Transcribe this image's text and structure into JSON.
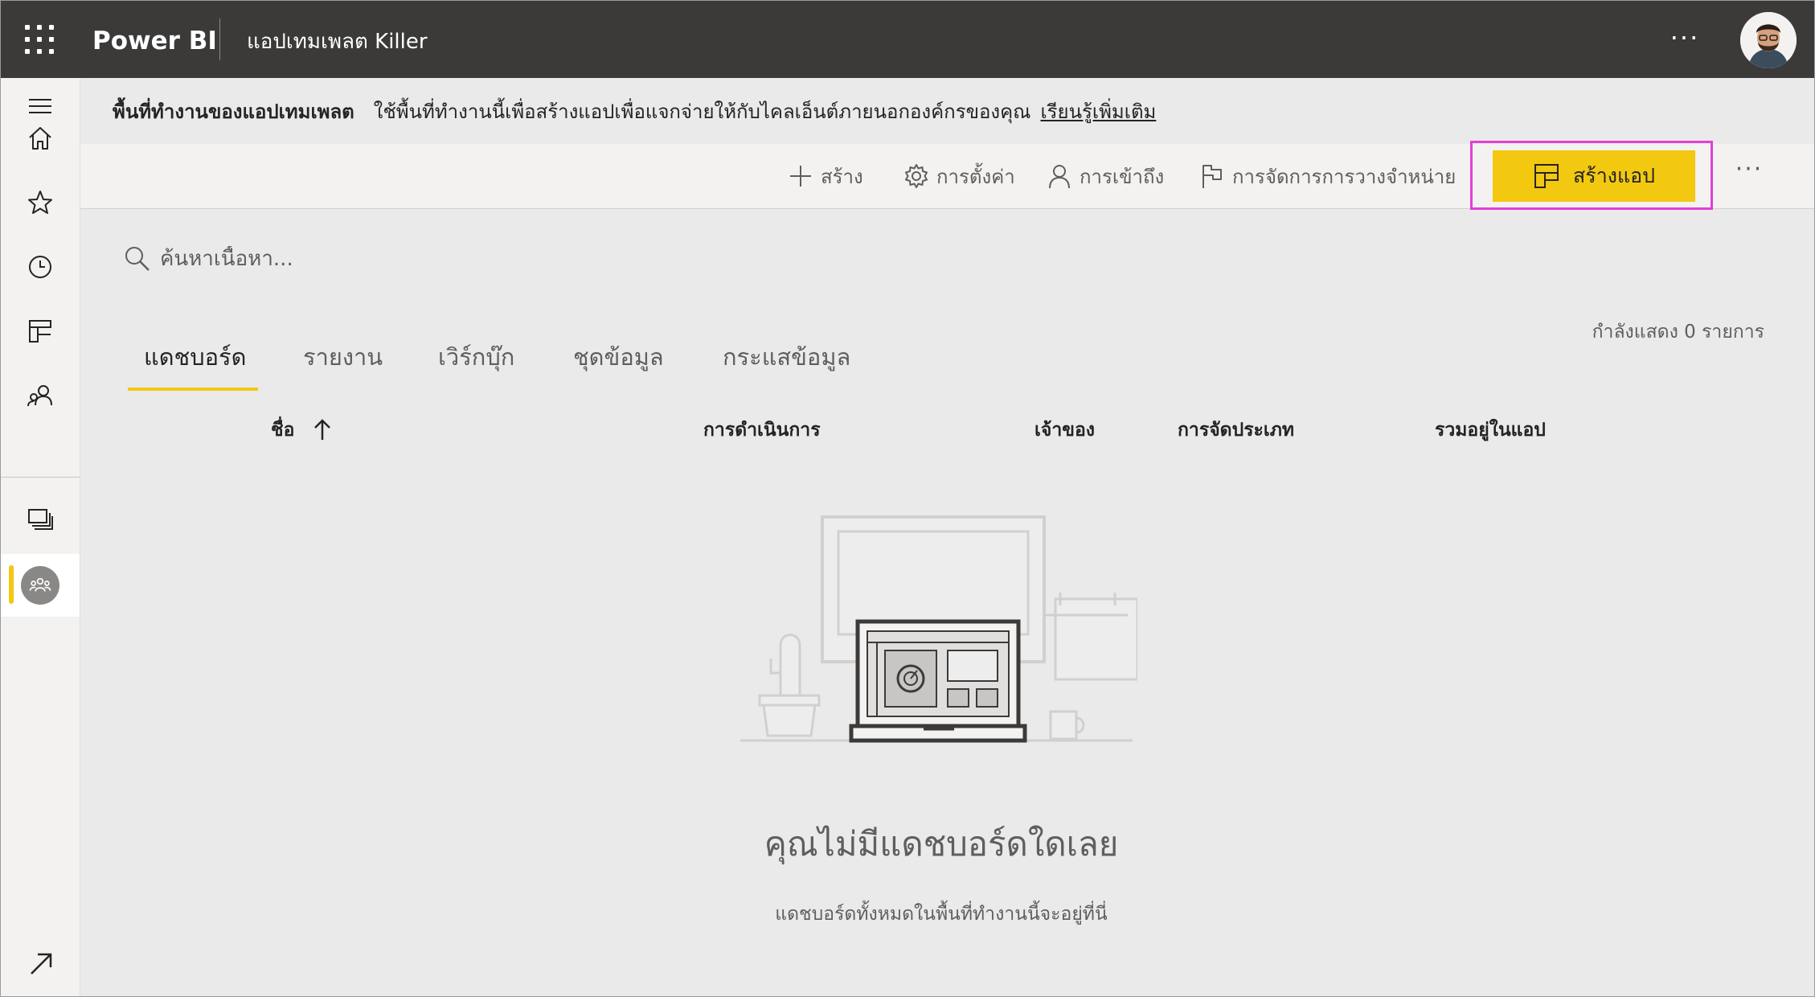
{
  "topbar": {
    "brand": "Power BI",
    "workspace_title": "แอปเทมเพลต Killer",
    "more_label": "···"
  },
  "banner": {
    "title": "พื้นที่ทำงานของแอปเทมเพลต",
    "description": "ใช้พื้นที่ทำงานนี้เพื่อสร้างแอปเพื่อแจกจ่ายให้กับไคลเอ็นต์ภายนอกองค์กรของคุณ",
    "link": "เรียนรู้เพิ่มเติม"
  },
  "actions": {
    "create": "สร้าง",
    "settings": "การตั้งค่า",
    "access": "การเข้าถึง",
    "release_management": "การจัดการการวางจำหน่าย",
    "create_app": "สร้างแอป",
    "more": "···"
  },
  "search": {
    "placeholder": "ค้นหาเนื้อหา..."
  },
  "showing": "กำลังแสดง 0 รายการ",
  "tabs": [
    {
      "label": "แดชบอร์ด",
      "active": true
    },
    {
      "label": "รายงาน"
    },
    {
      "label": "เวิร์กบุ๊ก"
    },
    {
      "label": "ชุดข้อมูล"
    },
    {
      "label": "กระแสข้อมูล"
    }
  ],
  "columns": {
    "name": "ชื่อ",
    "actions": "การดำเนินการ",
    "owner": "เจ้าของ",
    "classification": "การจัดประเภท",
    "included_in_app": "รวมอยู่ในแอป"
  },
  "empty_state": {
    "title": "คุณไม่มีแดชบอร์ดใดเลย",
    "subtitle": "แดชบอร์ดทั้งหมดในพื้นที่ทำงานนี้จะอยู่ที่นี่"
  },
  "nav_icons": [
    "menu-icon",
    "home-icon",
    "star-icon",
    "clock-icon",
    "apps-icon",
    "shared-icon",
    "workspaces-icon",
    "workspace-icon",
    "expand-icon"
  ],
  "colors": {
    "accent": "#f2c811",
    "highlight": "#e23fd6",
    "topbar": "#3b3a39"
  }
}
